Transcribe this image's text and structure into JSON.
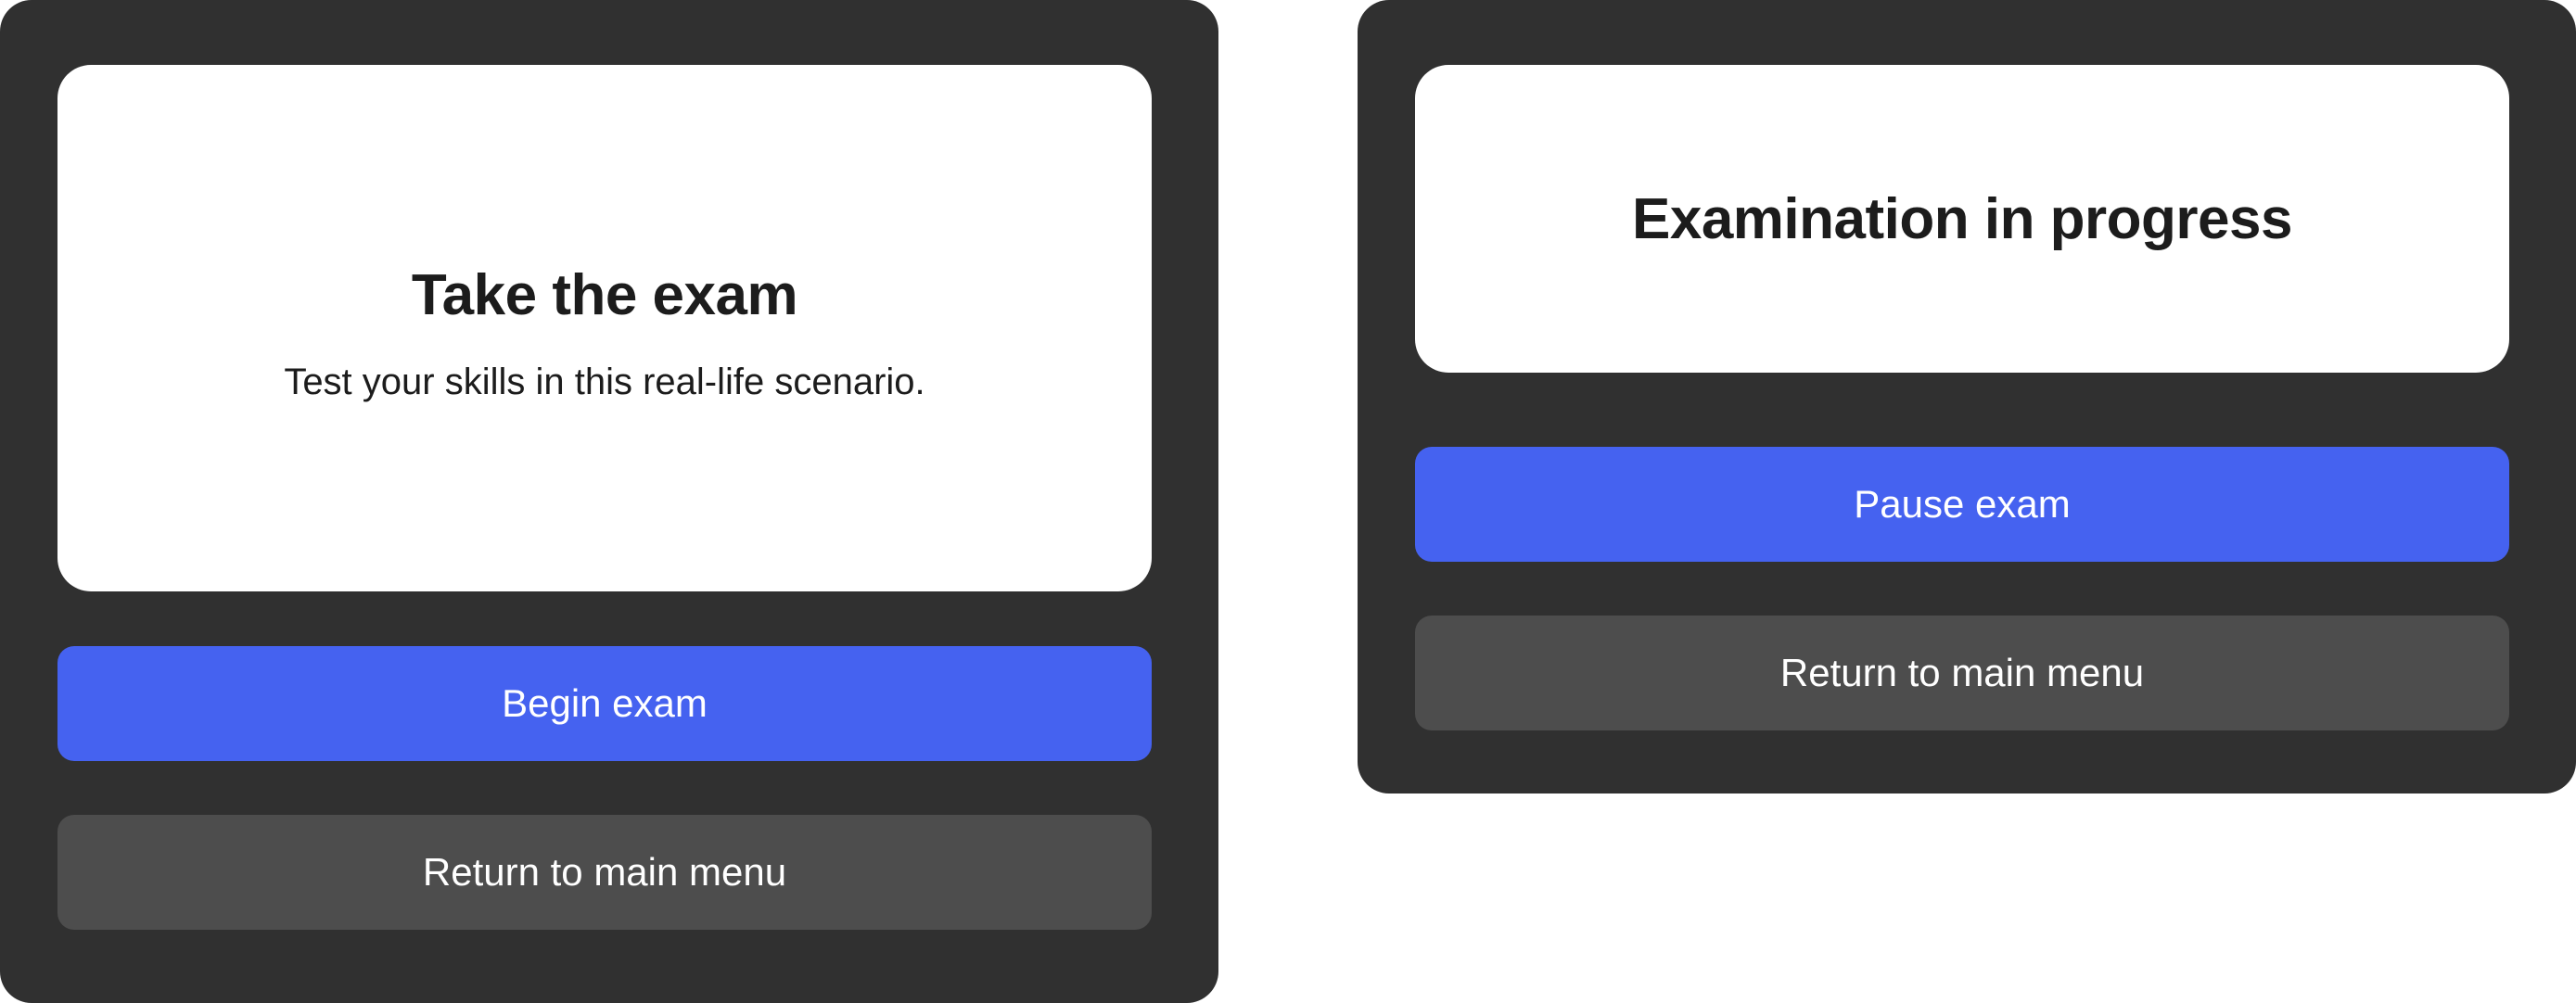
{
  "start_panel": {
    "title": "Take the exam",
    "subtitle": "Test your skills in this real-life scenario.",
    "primary_label": "Begin exam",
    "secondary_label": "Return to main menu"
  },
  "progress_panel": {
    "title": "Examination in progress",
    "primary_label": "Pause exam",
    "secondary_label": "Return to main menu"
  },
  "colors": {
    "panel_bg": "#303030",
    "card_bg": "#ffffff",
    "primary": "#4562f0",
    "secondary": "#4d4d4d",
    "text_dark": "#1c1c1c",
    "text_light": "#ffffff"
  }
}
